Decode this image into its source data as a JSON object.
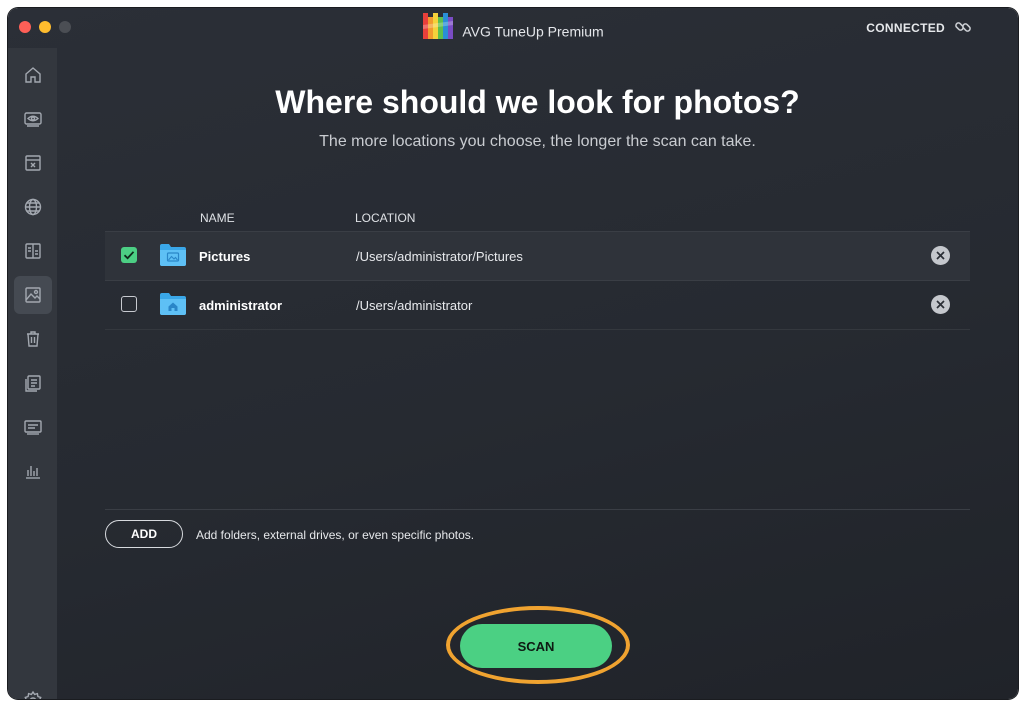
{
  "app": {
    "title": "AVG TuneUp Premium",
    "status": "CONNECTED"
  },
  "colors": {
    "accent": "#4bd083",
    "highlight_ring": "#f0a330",
    "background": "#262a31"
  },
  "sidebar": {
    "items": [
      {
        "icon": "home-icon"
      },
      {
        "icon": "eye-monitor-icon"
      },
      {
        "icon": "box-x-icon"
      },
      {
        "icon": "globe-icon"
      },
      {
        "icon": "duplicate-files-icon"
      },
      {
        "icon": "photos-icon",
        "active": true
      },
      {
        "icon": "trash-icon"
      },
      {
        "icon": "files-list-icon"
      },
      {
        "icon": "browser-window-icon"
      },
      {
        "icon": "bar-chart-icon"
      }
    ],
    "settings_icon": "gear-icon"
  },
  "main": {
    "heading": "Where should we look for photos?",
    "subheading": "The more locations you choose, the longer the scan can take.",
    "columns": {
      "name": "NAME",
      "location": "LOCATION"
    },
    "rows": [
      {
        "name": "Pictures",
        "location": "/Users/administrator/Pictures",
        "checked": true,
        "icon": "pictures-folder-icon"
      },
      {
        "name": "administrator",
        "location": "/Users/administrator",
        "checked": false,
        "icon": "home-folder-icon"
      }
    ],
    "add_label": "ADD",
    "add_hint": "Add folders, external drives, or even specific photos.",
    "scan_label": "SCAN"
  }
}
